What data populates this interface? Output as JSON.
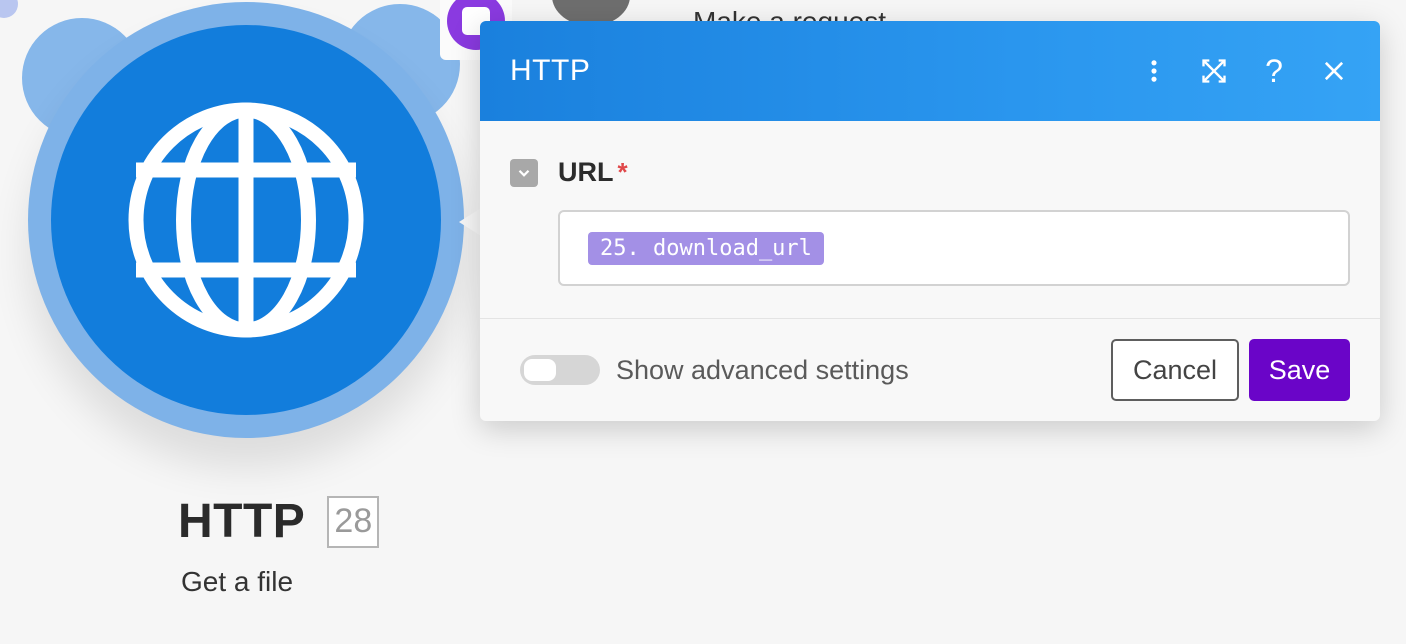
{
  "canvas": {
    "neighbour_label": "Make a request",
    "module": {
      "title": "HTTP",
      "badge": "28",
      "subtitle": "Get a file",
      "icon": "globe-icon",
      "colors": {
        "primary": "#127ddc",
        "halo": "#7eb2e8"
      }
    }
  },
  "dialog": {
    "title": "HTTP",
    "header_actions": [
      "more-vertical-icon",
      "maximize-icon",
      "help-icon",
      "close-icon"
    ],
    "help_glyph": "?",
    "field": {
      "label": "URL",
      "required_mark": "*",
      "value_pill": "25. download_url"
    },
    "footer": {
      "advanced_toggle_label": "Show advanced settings",
      "advanced_enabled": false,
      "cancel_label": "Cancel",
      "save_label": "Save"
    },
    "colors": {
      "header": "#1a80dd",
      "save": "#6a05c8",
      "pill": "#a390e6"
    }
  }
}
